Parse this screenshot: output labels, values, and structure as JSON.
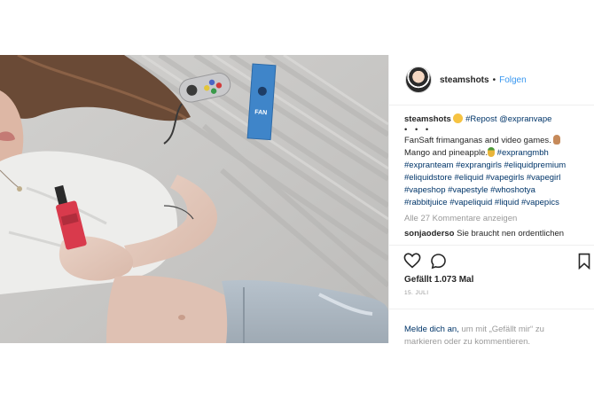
{
  "post": {
    "username": "steamshots",
    "separator": "•",
    "follow_label": "Folgen",
    "caption_author": "steamshots",
    "caption_tail": "#Repost @expranvape",
    "dots": "• • •",
    "text_line1_a": "FanSaft frimanganas and video games.",
    "text_line2_a": "Mango and pineapple.",
    "tags_1": "#exprangmbh",
    "tags_2": "#expranteam #exprangirls #eliquidpremium",
    "tags_3": "#eliquidstore #eliquid #vapegirls #vapegirl",
    "tags_4": "#vapeshop #vapestyle #whoshotya",
    "tags_5": "#rabbitjuice #vapeliquid #liquid #vapepics",
    "all_comments": "Alle 27 Kommentare anzeigen",
    "comment_user": "sonjaoderso",
    "comment_text": "Sie braucht nen ordentlichen",
    "likes": "Gefällt 1.073 Mal",
    "date": "15. JULI",
    "login_link": "Melde dich an,",
    "login_text": "um mit „Gefällt mir“ zu markieren oder zu kommentieren."
  },
  "photo": {
    "box_label": "FAN"
  },
  "icons": {
    "heart": "heart-icon",
    "comment": "comment-icon",
    "bookmark": "bookmark-icon"
  },
  "colors": {
    "link_blue": "#3897f0",
    "hashtag": "#003569",
    "muted": "#999999",
    "text": "#262626"
  }
}
